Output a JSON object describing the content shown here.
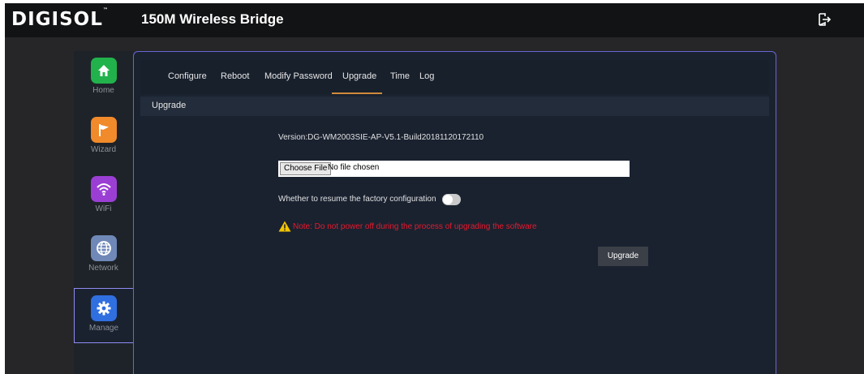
{
  "header": {
    "brand": "DIGISOL",
    "brand_mark": "™",
    "title": "150M Wireless Bridge",
    "logout_icon": "logout-icon"
  },
  "sidebar": {
    "items": [
      {
        "label": "Home",
        "icon": "home-icon",
        "color": "#22b24c"
      },
      {
        "label": "Wizard",
        "icon": "flag-icon",
        "color": "#f08a2a"
      },
      {
        "label": "WiFi",
        "icon": "wifi-icon",
        "color": "#9b3fd4"
      },
      {
        "label": "Network",
        "icon": "globe-icon",
        "color": "#6f88b7"
      },
      {
        "label": "Manage",
        "icon": "gear-icon",
        "color": "#2f6fe0",
        "active": true
      }
    ]
  },
  "tabs": [
    "Configure",
    "Reboot",
    "Modify Password",
    "Upgrade",
    "Time",
    "Log"
  ],
  "active_tab": "Upgrade",
  "section_title": "Upgrade",
  "version": "Version:DG-WM2003SIE-AP-V5.1-Build20181120172110",
  "file": {
    "button_label": "Choose File",
    "status": "No file chosen"
  },
  "resume_label": "Whether to resume the factory configuration",
  "resume_enabled": false,
  "note": "Note: Do not power off during the process of upgrading the software",
  "upgrade_button": "Upgrade",
  "colors": {
    "accent_border": "#6966d6",
    "tab_underline": "#d08a3a",
    "note": "#e8192c"
  }
}
